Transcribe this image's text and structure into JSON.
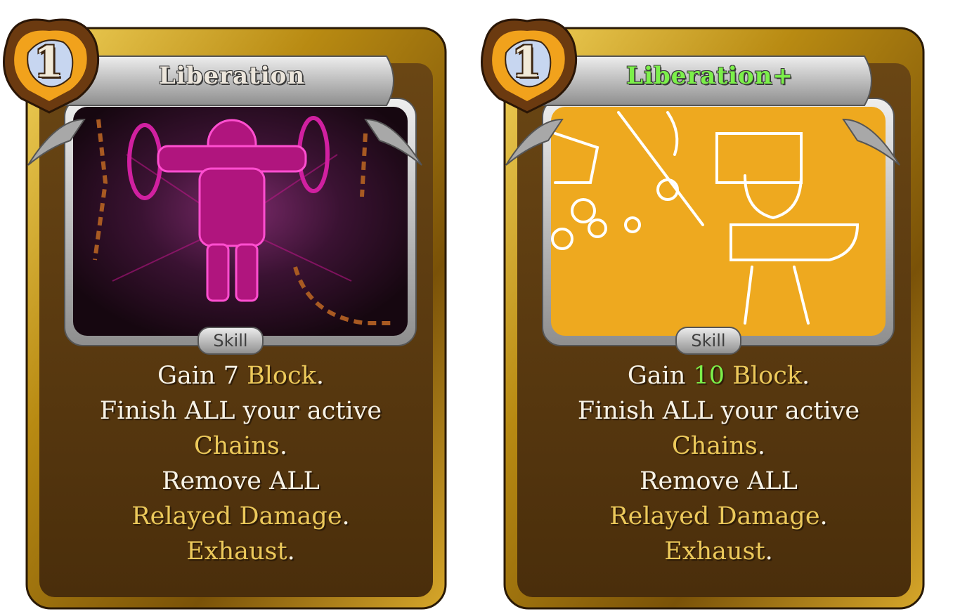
{
  "cards": [
    {
      "cost": "1",
      "title": "Liberation",
      "upgraded": false,
      "type": "Skill",
      "art": "pink-chained-figure-art",
      "description": {
        "line1_a": "Gain ",
        "line1_num": "7",
        "line1_kw": " Block",
        "line1_end": ".",
        "line2": "Finish ALL your active",
        "line3_kw": "Chains",
        "line3_end": ".",
        "line4": "Remove ALL",
        "line5_kw": "Relayed Damage",
        "line5_end": ".",
        "line6_kw": "Exhaust",
        "line6_end": "."
      }
    },
    {
      "cost": "1",
      "title": "Liberation+",
      "upgraded": true,
      "type": "Skill",
      "art": "orange-doodle-sketch-art",
      "description": {
        "line1_a": "Gain ",
        "line1_num": "10",
        "line1_kw": " Block",
        "line1_end": ".",
        "line2": "Finish ALL your active",
        "line3_kw": "Chains",
        "line3_end": ".",
        "line4": "Remove ALL",
        "line5_kw": "Relayed Damage",
        "line5_end": ".",
        "line6_kw": "Exhaust",
        "line6_end": "."
      }
    }
  ],
  "colors": {
    "frame_gold": "#b8860b",
    "body_brown": "#5a3a12",
    "keyword": "#ecc95b",
    "upgrade_green": "#7cf04a",
    "art_orange": "#eea91f",
    "art_pink": "#c0158a"
  }
}
